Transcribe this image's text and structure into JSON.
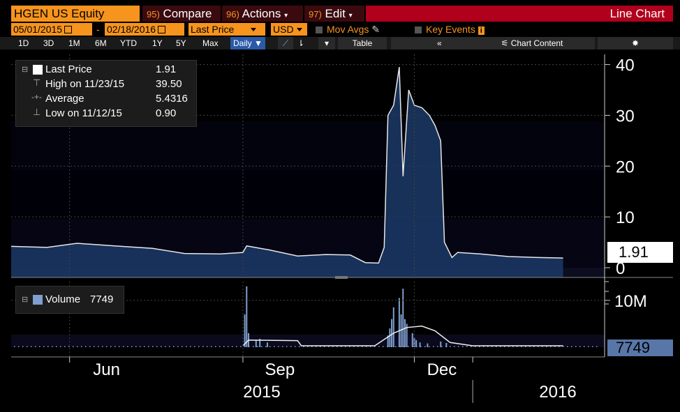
{
  "header": {
    "ticker": "HGEN US Equity",
    "compare_num": "95)",
    "compare_label": "Compare",
    "actions_num": "96)",
    "actions_label": "Actions",
    "edit_num": "97)",
    "edit_label": "Edit",
    "chart_type": "Line Chart"
  },
  "controls": {
    "start_date": "05/01/2015",
    "end_date": "02/18/2016",
    "field": "Last Price",
    "currency": "USD",
    "mov_avgs": "Mov Avgs",
    "key_events": "Key Events",
    "ranges": [
      "1D",
      "3D",
      "1M",
      "6M",
      "YTD",
      "1Y",
      "5Y",
      "Max"
    ],
    "frequency": "Daily",
    "table": "Table",
    "chart_content": "Chart Content"
  },
  "legend": {
    "last_price_label": "Last Price",
    "last_price_value": "1.91",
    "high_label": "High on 11/23/15",
    "high_value": "39.50",
    "average_label": "Average",
    "average_value": "5.4316",
    "low_label": "Low on 11/12/15",
    "low_value": "0.90",
    "volume_label": "Volume",
    "volume_value": "7749"
  },
  "tags": {
    "price": "1.91",
    "volume": "7749"
  },
  "colors": {
    "orange": "#f7941d",
    "red": "#b1001c",
    "price_fill": "#1c3a66",
    "volume_bar": "#7f9fd0"
  },
  "chart_data": {
    "type": "line",
    "price_axis": {
      "ylim": [
        0,
        42
      ],
      "ticks": [
        "40",
        "30",
        "20",
        "10",
        "0"
      ]
    },
    "volume_axis": {
      "ticks": [
        "10M"
      ]
    },
    "x_tick_labels": [
      "Jun",
      "Sep",
      "Dec"
    ],
    "year_labels": [
      "2015",
      "2016"
    ],
    "price_series": {
      "name": "Last Price",
      "points": [
        [
          "2015-05-01",
          4.2
        ],
        [
          "2015-05-20",
          4.0
        ],
        [
          "2015-06-05",
          4.8
        ],
        [
          "2015-06-25",
          4.3
        ],
        [
          "2015-07-15",
          3.8
        ],
        [
          "2015-08-01",
          2.8
        ],
        [
          "2015-08-20",
          2.7
        ],
        [
          "2015-09-01",
          3.0
        ],
        [
          "2015-09-03",
          4.3
        ],
        [
          "2015-09-15",
          3.5
        ],
        [
          "2015-09-30",
          2.3
        ],
        [
          "2015-10-15",
          2.6
        ],
        [
          "2015-10-28",
          2.5
        ],
        [
          "2015-11-05",
          1.0
        ],
        [
          "2015-11-12",
          0.9
        ],
        [
          "2015-11-15",
          4.0
        ],
        [
          "2015-11-17",
          30.0
        ],
        [
          "2015-11-20",
          32.0
        ],
        [
          "2015-11-23",
          39.5
        ],
        [
          "2015-11-25",
          18.0
        ],
        [
          "2015-11-28",
          35.0
        ],
        [
          "2015-12-01",
          32.0
        ],
        [
          "2015-12-05",
          31.5
        ],
        [
          "2015-12-09",
          30.0
        ],
        [
          "2015-12-12",
          28.0
        ],
        [
          "2015-12-15",
          25.0
        ],
        [
          "2015-12-17",
          5.0
        ],
        [
          "2015-12-21",
          2.0
        ],
        [
          "2015-12-24",
          3.0
        ],
        [
          "2016-01-05",
          2.7
        ],
        [
          "2016-01-20",
          2.2
        ],
        [
          "2016-02-05",
          2.0
        ],
        [
          "2016-02-18",
          1.91
        ]
      ]
    },
    "volume_series": {
      "name": "Volume",
      "bars": [
        [
          "2015-09-02",
          7.0
        ],
        [
          "2015-09-03",
          13.0
        ],
        [
          "2015-09-04",
          3.0
        ],
        [
          "2015-09-08",
          1.5
        ],
        [
          "2015-09-10",
          1.8
        ],
        [
          "2015-09-14",
          1.0
        ],
        [
          "2015-11-17",
          2.5
        ],
        [
          "2015-11-18",
          4.0
        ],
        [
          "2015-11-19",
          6.0
        ],
        [
          "2015-11-20",
          8.5
        ],
        [
          "2015-11-23",
          10.5
        ],
        [
          "2015-11-24",
          7.0
        ],
        [
          "2015-11-25",
          12.5
        ],
        [
          "2015-11-26",
          6.0
        ],
        [
          "2015-11-27",
          5.0
        ],
        [
          "2015-11-30",
          3.0
        ],
        [
          "2015-12-01",
          2.0
        ],
        [
          "2015-12-02",
          1.5
        ],
        [
          "2015-12-04",
          1.0
        ],
        [
          "2015-12-08",
          0.8
        ],
        [
          "2015-12-15",
          1.2
        ],
        [
          "2015-12-18",
          0.9
        ]
      ],
      "average_line": [
        [
          "2015-09-01",
          0.3
        ],
        [
          "2015-09-04",
          1.5
        ],
        [
          "2015-09-30",
          1.4
        ],
        [
          "2015-10-02",
          0.3
        ],
        [
          "2015-11-10",
          0.3
        ],
        [
          "2015-11-20",
          3.0
        ],
        [
          "2015-11-27",
          4.2
        ],
        [
          "2015-12-05",
          4.5
        ],
        [
          "2015-12-12",
          3.5
        ],
        [
          "2015-12-20",
          1.0
        ],
        [
          "2016-01-01",
          0.3
        ],
        [
          "2016-02-18",
          0.3
        ]
      ],
      "ylim": [
        0,
        14
      ]
    }
  }
}
